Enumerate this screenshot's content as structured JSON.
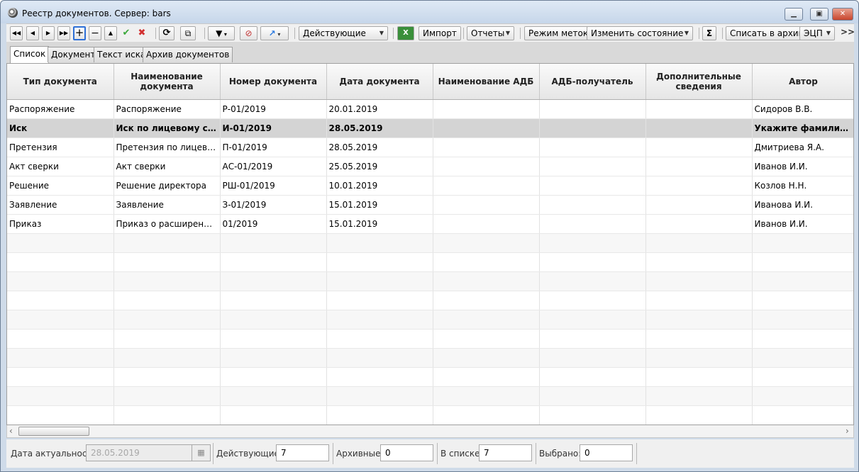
{
  "window": {
    "title": "Реестр документов. Сервер: bars"
  },
  "toolbar": {
    "filter_combo": "Действующие",
    "import": "Импорт",
    "reports": "Отчеты",
    "marks_mode": "Режим меток",
    "change_state": "Изменить состояние",
    "sum_symbol": "Σ",
    "archive": "Списать в архив",
    "esign": "ЭЦП",
    "more": ">>"
  },
  "tabs": [
    "Список",
    "Документ",
    "Текст иска",
    "Архив документов"
  ],
  "table": {
    "columns": [
      "Тип документа",
      "Наименование документа",
      "Номер документа",
      "Дата документа",
      "Наименование АДБ",
      "АДБ-получатель",
      "Дополнительные сведения",
      "Автор"
    ],
    "rows": [
      [
        "Распоряжение",
        "Распоряжение",
        "Р-01/2019",
        "20.01.2019",
        "",
        "",
        "",
        "Сидоров В.В."
      ],
      [
        "Иск",
        "Иск по лицевому счет…",
        "И-01/2019",
        "28.05.2019",
        "",
        "",
        "",
        "Укажите фамилию У.У."
      ],
      [
        "Претензия",
        "Претензия по лицевому…",
        "П-01/2019",
        "28.05.2019",
        "",
        "",
        "",
        "Дмитриева Я.А."
      ],
      [
        "Акт сверки",
        "Акт сверки",
        "АС-01/2019",
        "25.05.2019",
        "",
        "",
        "",
        "Иванов И.И."
      ],
      [
        "Решение",
        "Решение директора",
        "РШ-01/2019",
        "10.01.2019",
        "",
        "",
        "",
        "Козлов Н.Н."
      ],
      [
        "Заявление",
        "Заявление",
        "З-01/2019",
        "15.01.2019",
        "",
        "",
        "",
        "Иванова И.И."
      ],
      [
        "Приказ",
        "Приказ о расширении …",
        "01/2019",
        "15.01.2019",
        "",
        "",
        "",
        "Иванов И.И."
      ]
    ],
    "selected_row": 1,
    "empty_rows": 10
  },
  "status": {
    "date_label": "Дата актуальности",
    "date_value": "28.05.2019",
    "active_label": "Действующие:",
    "active_value": "7",
    "archived_label": "Архивные:",
    "archived_value": "0",
    "in_list_label": "В списке:",
    "in_list_value": "7",
    "selected_label": "Выбрано:",
    "selected_value": "0"
  },
  "colors": {
    "selected_row_bg": "#d4d4d4",
    "add_button_border": "#2d6fd6",
    "check_green": "#3aa83a",
    "delete_red": "#d23030"
  }
}
